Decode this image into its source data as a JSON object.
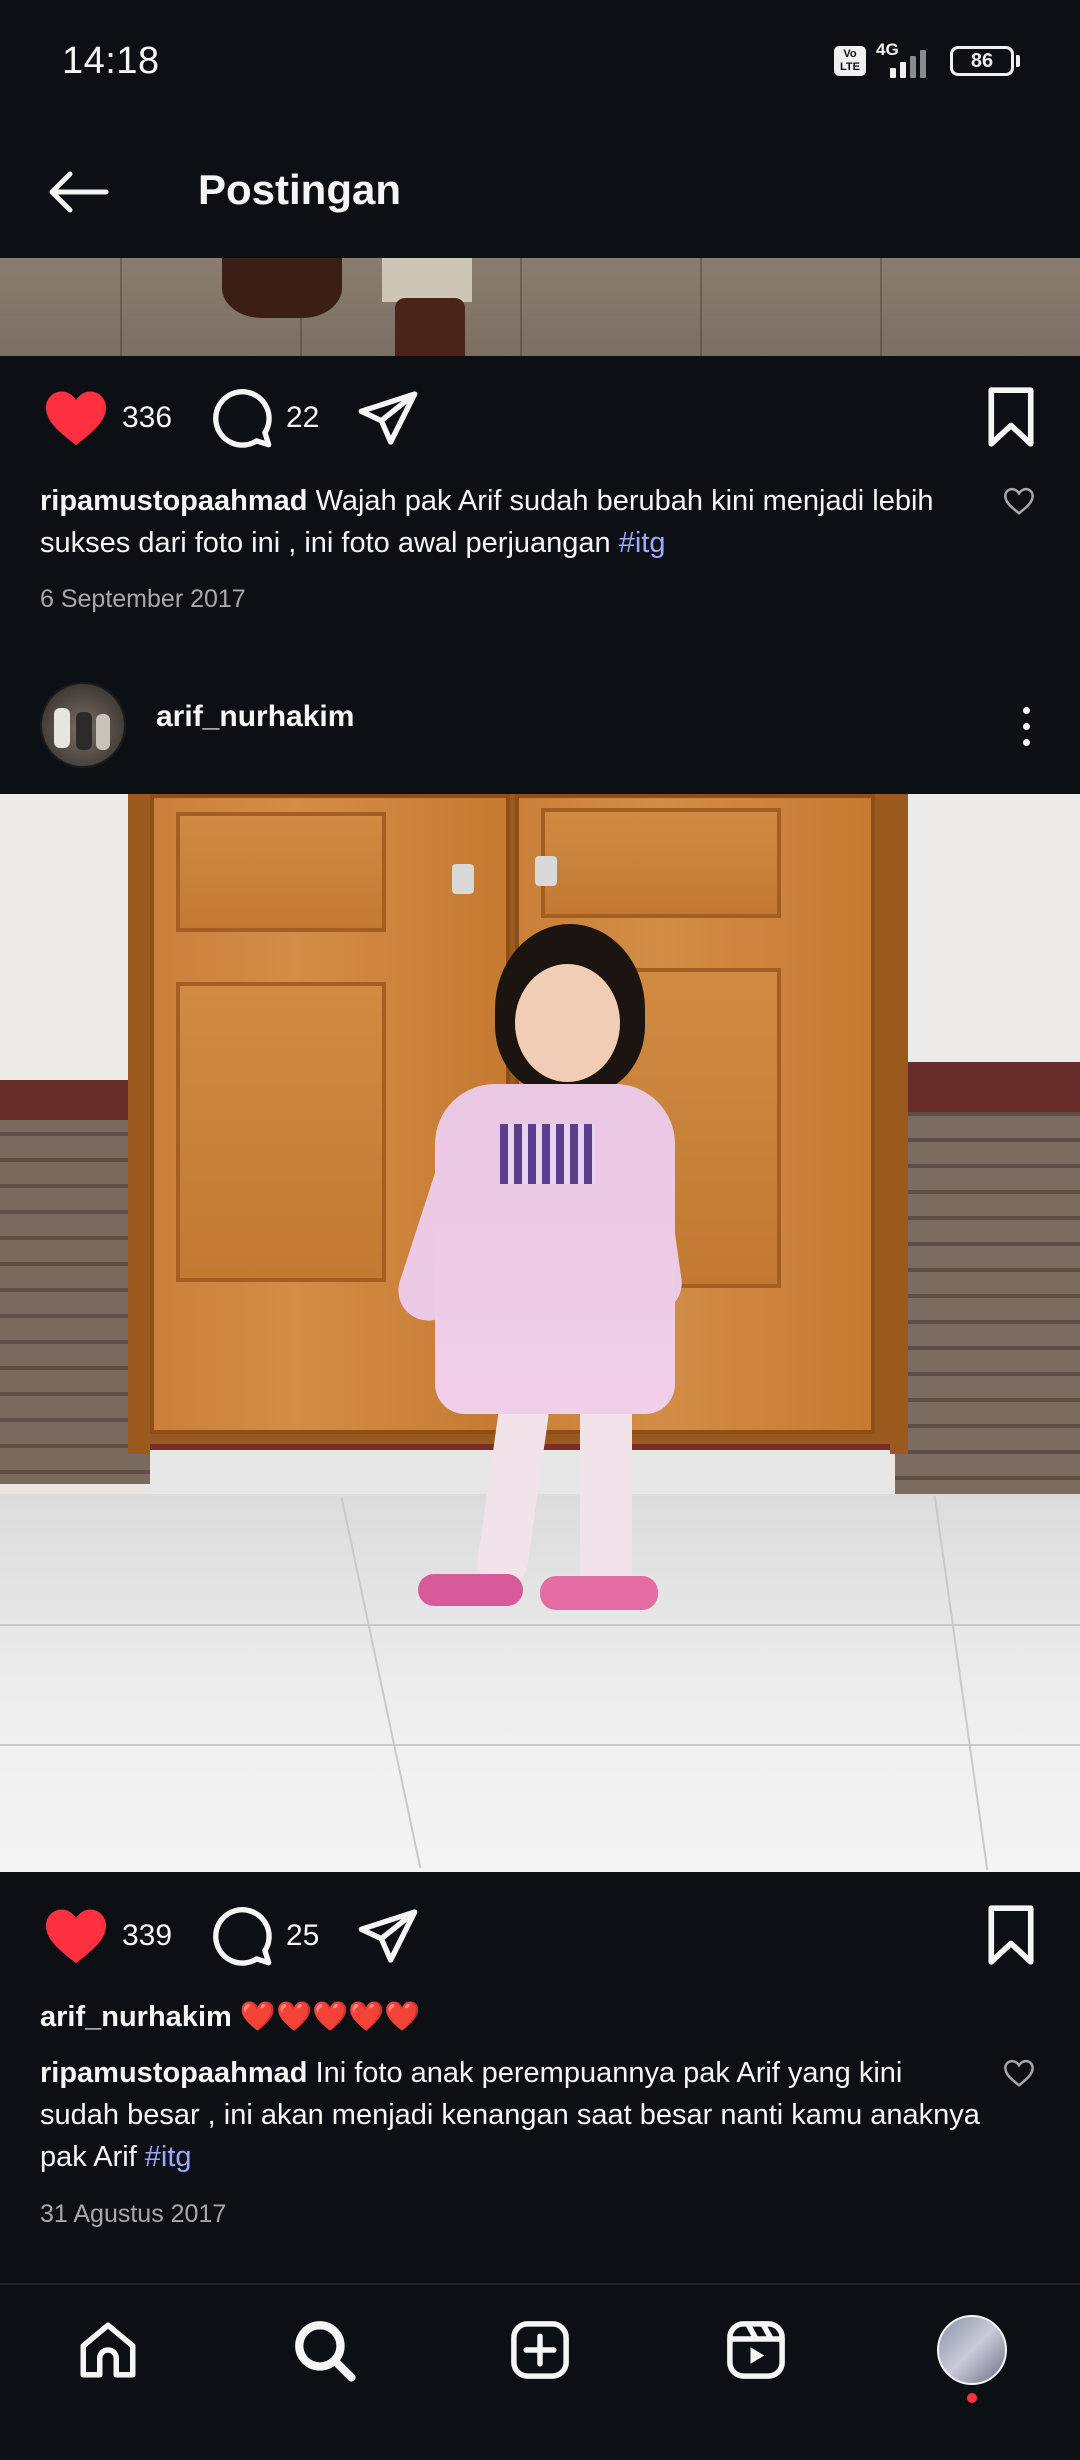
{
  "status": {
    "time": "14:18",
    "network": "4G",
    "volte": "Vo LTE",
    "battery": "86"
  },
  "header": {
    "title": "Postingan"
  },
  "post1": {
    "likes": "336",
    "comments": "22",
    "caption_user": "ripamustopaahmad",
    "caption_text": "Wajah pak Arif sudah berubah kini menjadi lebih sukses dari foto ini , ini foto awal perjuangan",
    "caption_tag": "#itg",
    "date": "6 September 2017"
  },
  "post2": {
    "username": "arif_nurhakim",
    "likes": "339",
    "comments": "25",
    "owner_comment_user": "arif_nurhakim",
    "owner_comment_text": "❤️❤️❤️❤️❤️",
    "caption_user": "ripamustopaahmad",
    "caption_text": "Ini foto anak perempuannya pak Arif yang kini sudah besar , ini akan menjadi kenangan saat besar nanti kamu anaknya pak Arif",
    "caption_tag": "#itg",
    "date": "31 Agustus 2017"
  },
  "icons": {
    "like": "heart-filled-icon",
    "comment": "comment-icon",
    "share": "send-icon",
    "save": "bookmark-icon",
    "nav": [
      "home-icon",
      "search-icon",
      "create-icon",
      "reels-icon",
      "profile-avatar"
    ]
  },
  "colors": {
    "background": "#0c1014",
    "like_red": "#ff3040",
    "hashtag": "#9ea7ff",
    "muted_text": "#a8a8a8"
  }
}
